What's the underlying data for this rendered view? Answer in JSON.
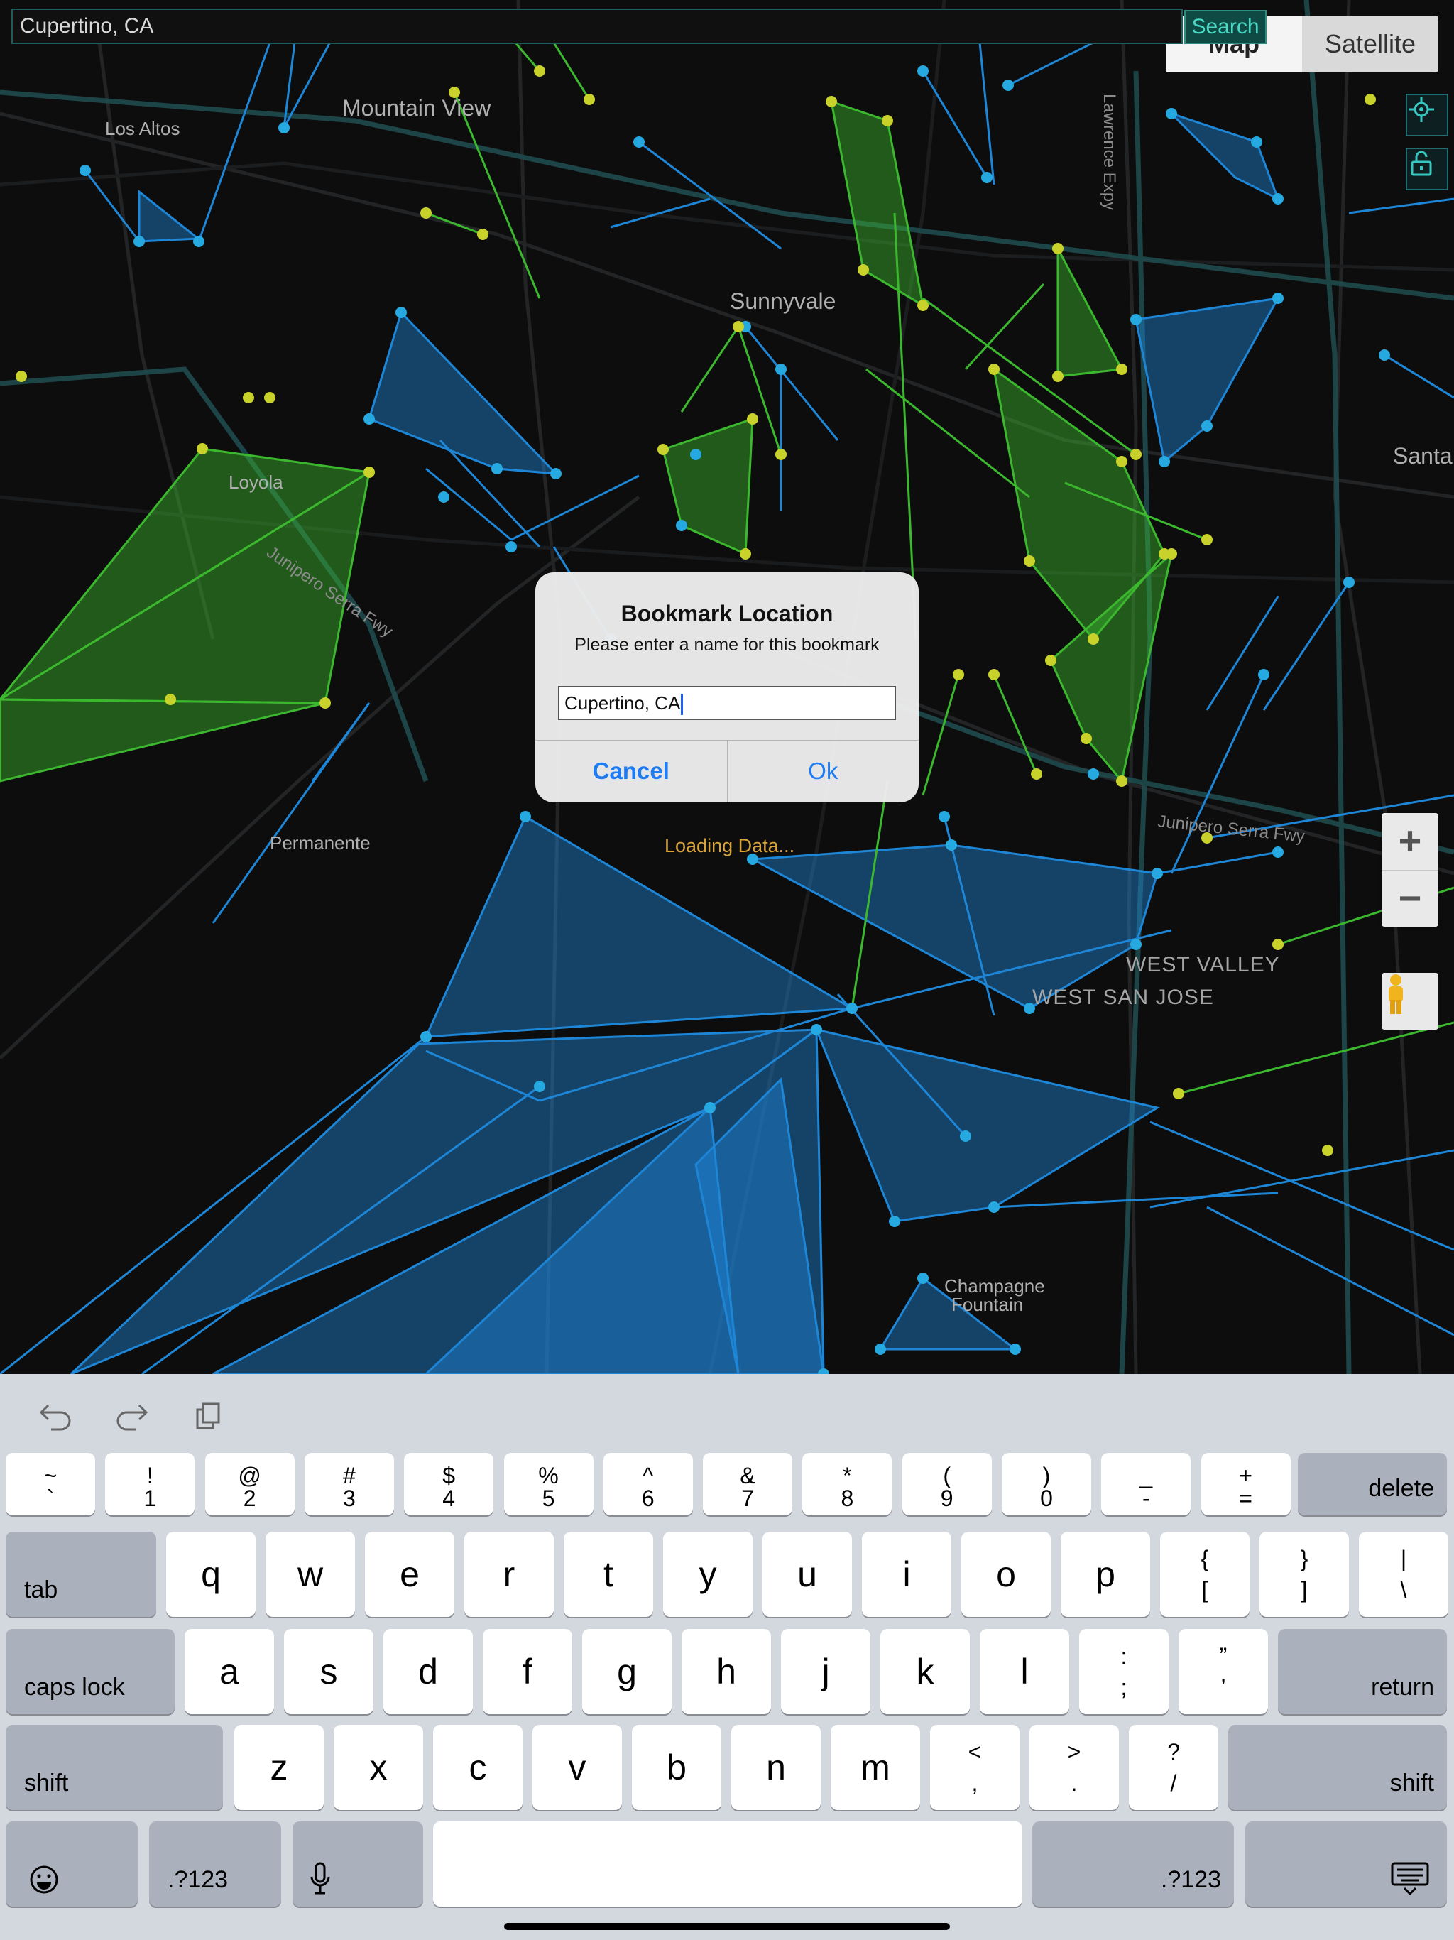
{
  "search": {
    "value": "Cupertino, CA",
    "button": "Search"
  },
  "map_type": {
    "options": [
      "Map",
      "Satellite"
    ],
    "selected": "Map"
  },
  "map": {
    "loading_text": "Loading Data...",
    "labels": {
      "mountain_view": "Mountain View",
      "los_altos": "Los Altos",
      "sunnyvale": "Sunnyvale",
      "loyola": "Loyola",
      "permanente": "Permanente",
      "santa": "Santa",
      "west_valley": "WEST VALLEY",
      "west_san_jose": "WEST SAN JOSE",
      "champagne": "Champagne",
      "fountain": "Fountain",
      "junipero": "Junipero Serra Fwy",
      "lawrence": "Lawrence Expy"
    }
  },
  "dialog": {
    "title": "Bookmark Location",
    "message": "Please enter a name for this bookmark",
    "input_value": "Cupertino, CA",
    "cancel": "Cancel",
    "ok": "Ok"
  },
  "keyboard": {
    "row1": [
      [
        "~",
        "`"
      ],
      [
        "!",
        "1"
      ],
      [
        "@",
        "2"
      ],
      [
        "#",
        "3"
      ],
      [
        "$",
        "4"
      ],
      [
        "%",
        "5"
      ],
      [
        "^",
        "6"
      ],
      [
        "&",
        "7"
      ],
      [
        "*",
        "8"
      ],
      [
        "(",
        "9"
      ],
      [
        ")",
        "0"
      ],
      [
        "_",
        "-"
      ],
      [
        "+",
        "="
      ]
    ],
    "delete": "delete",
    "tab": "tab",
    "row2": [
      "q",
      "w",
      "e",
      "r",
      "t",
      "y",
      "u",
      "i",
      "o",
      "p"
    ],
    "row2_sym": [
      [
        "{",
        "["
      ],
      [
        "}",
        "]"
      ],
      [
        "|",
        "\\"
      ]
    ],
    "caps": "caps lock",
    "row3": [
      "a",
      "s",
      "d",
      "f",
      "g",
      "h",
      "j",
      "k",
      "l"
    ],
    "row3_sym": [
      [
        ":",
        ";"
      ],
      [
        "”",
        "’"
      ]
    ],
    "return": "return",
    "shift": "shift",
    "row4": [
      "z",
      "x",
      "c",
      "v",
      "b",
      "n",
      "m"
    ],
    "row4_sym": [
      [
        "<",
        ","
      ],
      [
        ">",
        "."
      ],
      [
        "?",
        "/"
      ]
    ],
    "num": ".?123"
  },
  "colors": {
    "blue": "#1e86d6",
    "green": "#3cb82e",
    "yellow": "#c9d22a",
    "accent": "#1d7bf3"
  }
}
